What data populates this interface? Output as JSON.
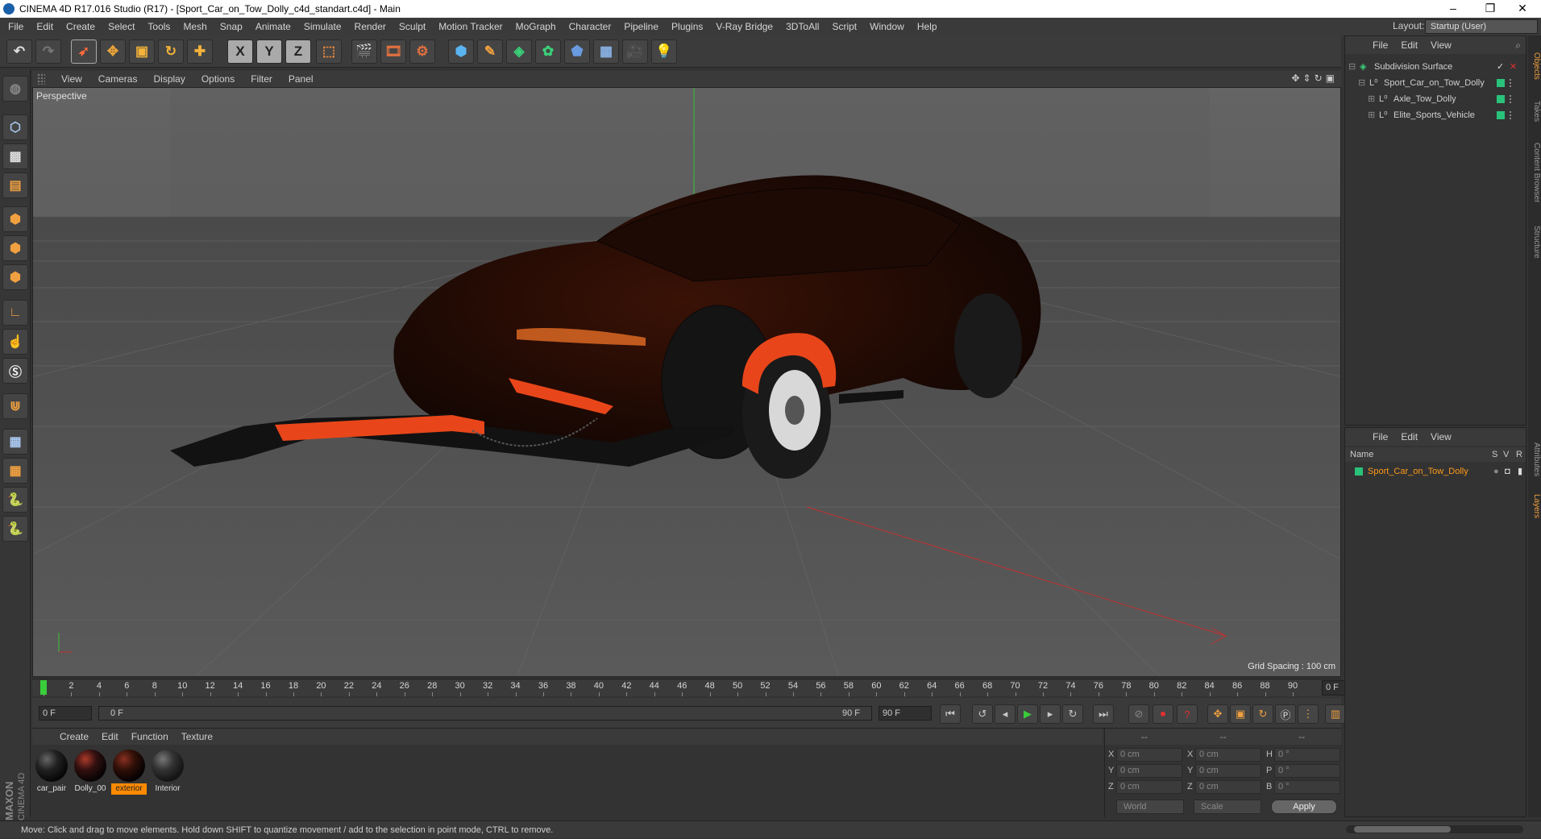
{
  "window": {
    "title": "CINEMA 4D R17.016 Studio (R17) - [Sport_Car_on_Tow_Dolly_c4d_standart.c4d] - Main"
  },
  "menubar": {
    "items": [
      "File",
      "Edit",
      "Create",
      "Select",
      "Tools",
      "Mesh",
      "Snap",
      "Animate",
      "Simulate",
      "Render",
      "Sculpt",
      "Motion Tracker",
      "MoGraph",
      "Character",
      "Pipeline",
      "Plugins",
      "V-Ray Bridge",
      "3DToAll",
      "Script",
      "Window",
      "Help"
    ]
  },
  "layout": {
    "label": "Layout:",
    "value": "Startup (User)"
  },
  "toolbar": {
    "x": "X",
    "y": "Y",
    "z": "Z"
  },
  "viewport": {
    "menu": [
      "View",
      "Cameras",
      "Display",
      "Options",
      "Filter",
      "Panel"
    ],
    "label": "Perspective",
    "grid_spacing": "Grid Spacing : 100 cm"
  },
  "timeline": {
    "ticks": [
      "0",
      "2",
      "4",
      "6",
      "8",
      "10",
      "12",
      "14",
      "16",
      "18",
      "20",
      "22",
      "24",
      "26",
      "28",
      "30",
      "32",
      "34",
      "36",
      "38",
      "40",
      "42",
      "44",
      "46",
      "48",
      "50",
      "52",
      "54",
      "56",
      "58",
      "60",
      "62",
      "64",
      "66",
      "68",
      "70",
      "72",
      "74",
      "76",
      "78",
      "80",
      "82",
      "84",
      "86",
      "88",
      "90"
    ],
    "current_frame": "0 F"
  },
  "playback": {
    "start_field": "0 F",
    "range_start": "0 F",
    "range_end": "90 F",
    "end_field": "90 F"
  },
  "materials": {
    "menu": [
      "Create",
      "Edit",
      "Function",
      "Texture"
    ],
    "items": [
      {
        "label": "car_pair",
        "selected": false
      },
      {
        "label": "Dolly_00",
        "selected": false
      },
      {
        "label": "exterior",
        "selected": true
      },
      {
        "label": "Interior",
        "selected": false
      }
    ],
    "selected_color": "#ff8a00"
  },
  "coordinates": {
    "head": [
      "--",
      "--",
      "--"
    ],
    "rows": [
      {
        "a": "X",
        "av": "0 cm",
        "b": "X",
        "bv": "0 cm",
        "c": "H",
        "cv": "0 °"
      },
      {
        "a": "Y",
        "av": "0 cm",
        "b": "Y",
        "bv": "0 cm",
        "c": "P",
        "cv": "0 °"
      },
      {
        "a": "Z",
        "av": "0 cm",
        "b": "Z",
        "bv": "0 cm",
        "c": "B",
        "cv": "0 °"
      }
    ],
    "world": "World",
    "scale": "Scale",
    "apply": "Apply"
  },
  "objects": {
    "menu": [
      "File",
      "Edit",
      "View"
    ],
    "tree": [
      {
        "name": "Subdivision Surface",
        "depth": 0
      },
      {
        "name": "Sport_Car_on_Tow_Dolly",
        "depth": 1
      },
      {
        "name": "Axle_Tow_Dolly",
        "depth": 2
      },
      {
        "name": "Elite_Sports_Vehicle",
        "depth": 2
      }
    ],
    "tag_color": "#29c27a"
  },
  "attributes": {
    "menu": [
      "File",
      "Edit",
      "View"
    ],
    "columns": {
      "name": "Name",
      "s": "S",
      "v": "V",
      "r": "R"
    },
    "row": "Sport_Car_on_Tow_Dolly",
    "row_color": "#ff9a1a"
  },
  "side_tabs": [
    "Objects",
    "Takes",
    "Content Browser",
    "Structure",
    "Attributes",
    "Layers"
  ],
  "status": {
    "text": "Move: Click and drag to move elements. Hold down SHIFT to quantize movement / add to the selection in point mode, CTRL to remove."
  },
  "brand": {
    "line1": "MAXON",
    "line2": "CINEMA 4D"
  }
}
